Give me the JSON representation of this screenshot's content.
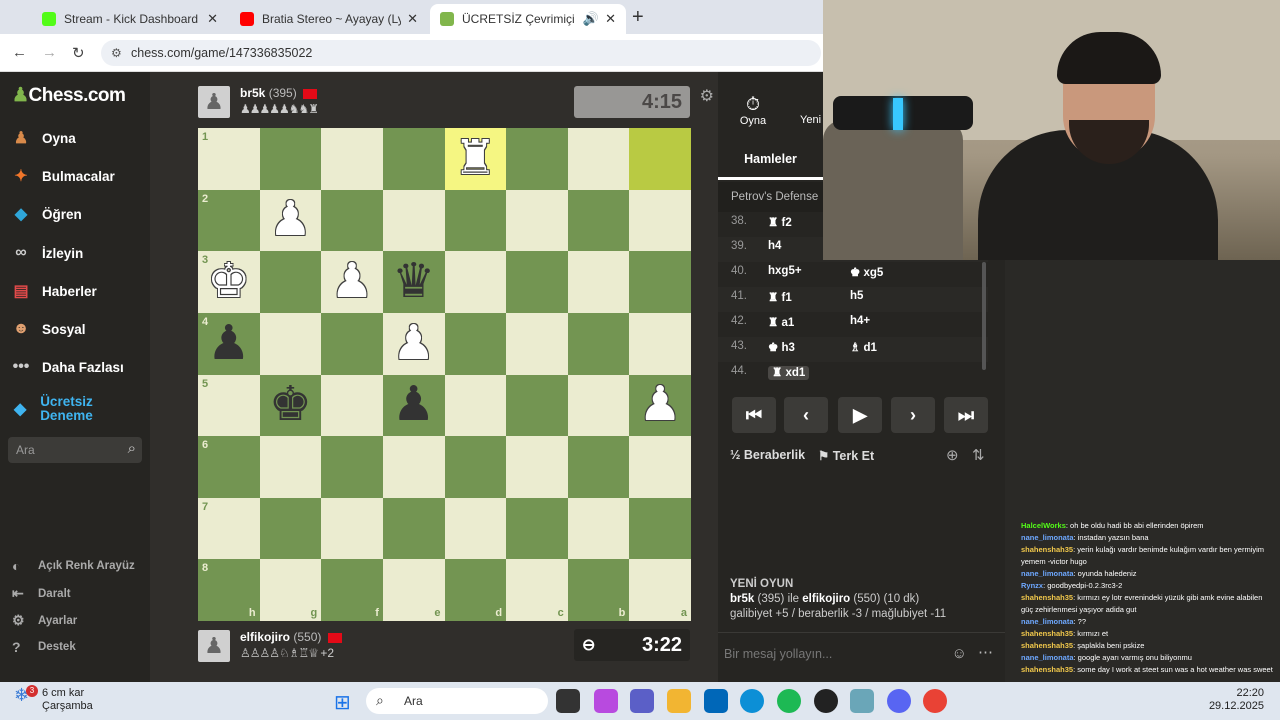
{
  "tabs": [
    {
      "title": "Stream - Kick Dashboard",
      "favicon_color": "#53fc18"
    },
    {
      "title": "Bratia Stereo ~ Ayayay (Lyrics) f",
      "favicon_color": "#ff0000"
    },
    {
      "title": "ÜCRETSİZ Çevrimiçi Satranç",
      "favicon_color": "#81b64c"
    }
  ],
  "address": {
    "url": "chess.com/game/147336835022"
  },
  "sidebar": {
    "logo": "Chess.com",
    "items": [
      {
        "label": "Oyna",
        "icon": "pawn-play-icon"
      },
      {
        "label": "Bulmacalar",
        "icon": "puzzle-icon"
      },
      {
        "label": "Öğren",
        "icon": "learn-icon"
      },
      {
        "label": "İzleyin",
        "icon": "binoculars-icon"
      },
      {
        "label": "Haberler",
        "icon": "news-icon"
      },
      {
        "label": "Sosyal",
        "icon": "social-icon"
      },
      {
        "label": "Daha Fazlası",
        "icon": "more-icon"
      },
      {
        "label": "Ücretsiz Deneme",
        "icon": "diamond-icon"
      }
    ],
    "search_placeholder": "Ara",
    "bottom": [
      {
        "label": "Açık Renk Arayüz",
        "icon": "contrast-icon"
      },
      {
        "label": "Daralt",
        "icon": "collapse-icon"
      },
      {
        "label": "Ayarlar",
        "icon": "settings-icon"
      },
      {
        "label": "Destek",
        "icon": "help-icon"
      }
    ]
  },
  "top_player": {
    "name": "br5k",
    "rating": "(395)",
    "captured": "♟♟♟♟♟♞♞♜",
    "clock": "4:15"
  },
  "bottom_player": {
    "name": "elfikojiro",
    "rating": "(550)",
    "captured": "♙♙♙♙♘♗♖♕",
    "advantage": "+2",
    "clock": "3:22"
  },
  "board": {
    "orientation": "black",
    "ranks": [
      "1",
      "2",
      "3",
      "4",
      "5",
      "6",
      "7",
      "8"
    ],
    "files": [
      "h",
      "g",
      "f",
      "e",
      "d",
      "c",
      "b",
      "a"
    ],
    "highlight": [
      "d1",
      "a1"
    ],
    "pieces": {
      "d1": "R",
      "g2": "P",
      "h3": "K",
      "f3": "P",
      "e3": "q",
      "h4": "p",
      "e4": "P",
      "g5": "k",
      "e5": "p",
      "a5": "P"
    }
  },
  "panel": {
    "tab_play": "Oyna",
    "tab_new": "Yeni",
    "moves_title": "Hamleler",
    "opening": "Petrov's Defense",
    "moves": [
      {
        "num": "38.",
        "white": "♜ f2",
        "black": ""
      },
      {
        "num": "39.",
        "white": "h4",
        "black": ""
      },
      {
        "num": "40.",
        "white": "hxg5+",
        "black": "♚ xg5"
      },
      {
        "num": "41.",
        "white": "♜ f1",
        "black": "h5"
      },
      {
        "num": "42.",
        "white": "♜ a1",
        "black": "h4+"
      },
      {
        "num": "43.",
        "white": "♚ h3",
        "black": "♗ d1"
      },
      {
        "num": "44.",
        "white": "♜ xd1",
        "black": ""
      }
    ],
    "controls": [
      "⏮",
      "‹",
      "▶",
      "›",
      "⏭"
    ],
    "draw": "Beraberlik",
    "resign": "Terk Et",
    "new_game": {
      "heading": "YENİ OYUN",
      "line1_p1": "br5k",
      "line1_r1": "(395)",
      "line1_mid": "ile",
      "line1_p2": "elfikojiro",
      "line1_r2": "(550) (10 dk)",
      "line2": "galibiyet +5 / beraberlik -3 / mağlubiyet -11"
    },
    "message_placeholder": "Bir mesaj yollayın..."
  },
  "chat": [
    {
      "user": "HalcelWorks",
      "color": "g",
      "text": ": oh be oldu hadi bb abi ellerinden öpirem"
    },
    {
      "user": "nane_limonata",
      "color": "b",
      "text": ": instadan yazsın bana"
    },
    {
      "user": "shahenshah35",
      "color": "y",
      "text": ": yerin kulağı vardır benimde kulağım vardır ben yermiyim yemem -victor hugo"
    },
    {
      "user": "nane_limonata",
      "color": "b",
      "text": ": oyunda haledeniz"
    },
    {
      "user": "Rynzx",
      "color": "b",
      "text": ": goodbyedpi-0.2.3rc3-2"
    },
    {
      "user": "shahenshah35",
      "color": "y",
      "text": ": kırmızı ey lotr evrenindeki yüzük gibi amk evine alabilen güç zehirlenmesi yaşıyor adida gut"
    },
    {
      "user": "nane_limonata",
      "color": "b",
      "text": ": ??"
    },
    {
      "user": "shahenshah35",
      "color": "y",
      "text": ": kırmızı et"
    },
    {
      "user": "shahenshah35",
      "color": "y",
      "text": ": şaplakla beni pskize"
    },
    {
      "user": "nane_limonata",
      "color": "b",
      "text": ": google ayarı varmış onu biliyonmu"
    },
    {
      "user": "shahenshah35",
      "color": "y",
      "text": ": some day I work at steet sun was a hot weather was sweet"
    }
  ],
  "taskbar": {
    "weather_temp": "6 cm kar",
    "weather_day": "Çarşamba",
    "weather_badge": "3",
    "search": "Ara",
    "time": "22:20",
    "date": "29.12.2025"
  }
}
